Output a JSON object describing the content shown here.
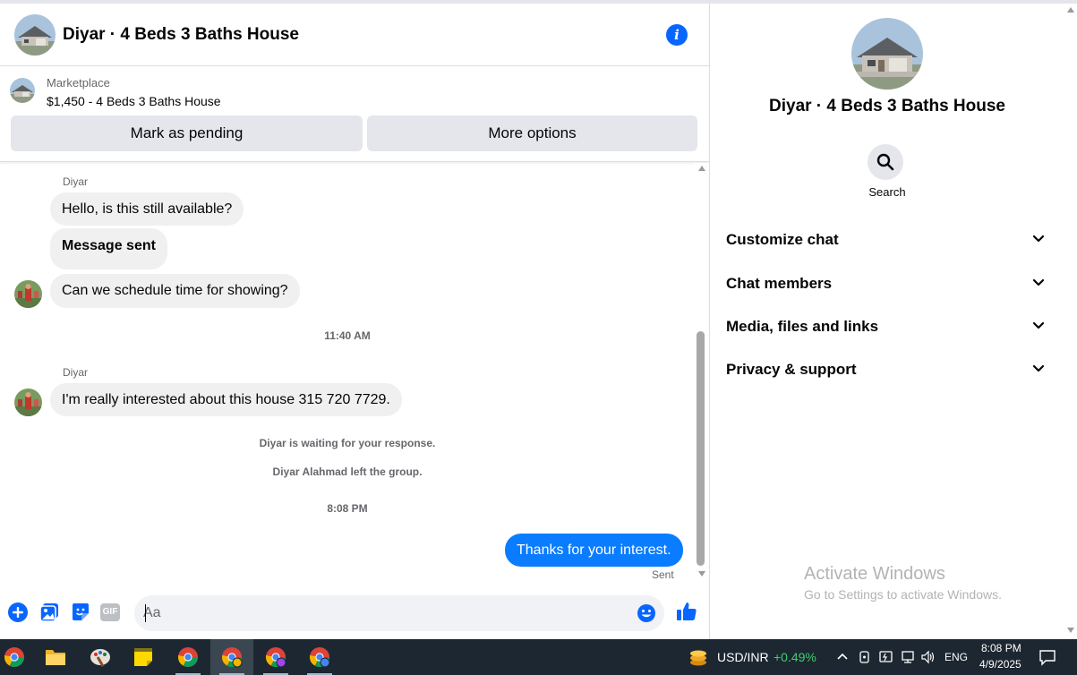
{
  "chat": {
    "title": "Diyar · 4 Beds 3 Baths House",
    "info_icon": "info-icon",
    "listing": {
      "category": "Marketplace",
      "price_title": "$1,450 - 4 Beds 3 Baths House",
      "mark_pending_label": "Mark as pending",
      "more_options_label": "More options"
    },
    "messages": {
      "sender_1": "Diyar",
      "msg_1": "Hello, is this still available?",
      "msg_2": "Message sent",
      "msg_3": "Can we schedule time for showing?",
      "time_1": "11:40 AM",
      "sender_2": "Diyar",
      "msg_4": "I'm really interested about this house 315 720 7729.",
      "system_1": "Diyar is waiting for your response.",
      "system_2": "Diyar Alahmad left the group.",
      "time_2": "8:08 PM",
      "msg_out": "Thanks for your interest.",
      "sent_status": "Sent"
    },
    "composer": {
      "placeholder": "Aa",
      "gif_label": "GIF"
    },
    "colors": {
      "accent": "#0866ff",
      "outgoing_bubble": "#0a7cff",
      "incoming_bubble": "#f0f0f0"
    }
  },
  "details": {
    "title": "Diyar · 4 Beds 3 Baths House",
    "search_label": "Search",
    "sections": [
      "Customize chat",
      "Chat members",
      "Media, files and links",
      "Privacy & support"
    ]
  },
  "watermark": {
    "title": "Activate Windows",
    "subtitle": "Go to Settings to activate Windows."
  },
  "taskbar": {
    "currency_pair": "USD/INR",
    "currency_change": "+0.49%",
    "language": "ENG",
    "time": "8:08 PM",
    "date": "4/9/2025"
  }
}
